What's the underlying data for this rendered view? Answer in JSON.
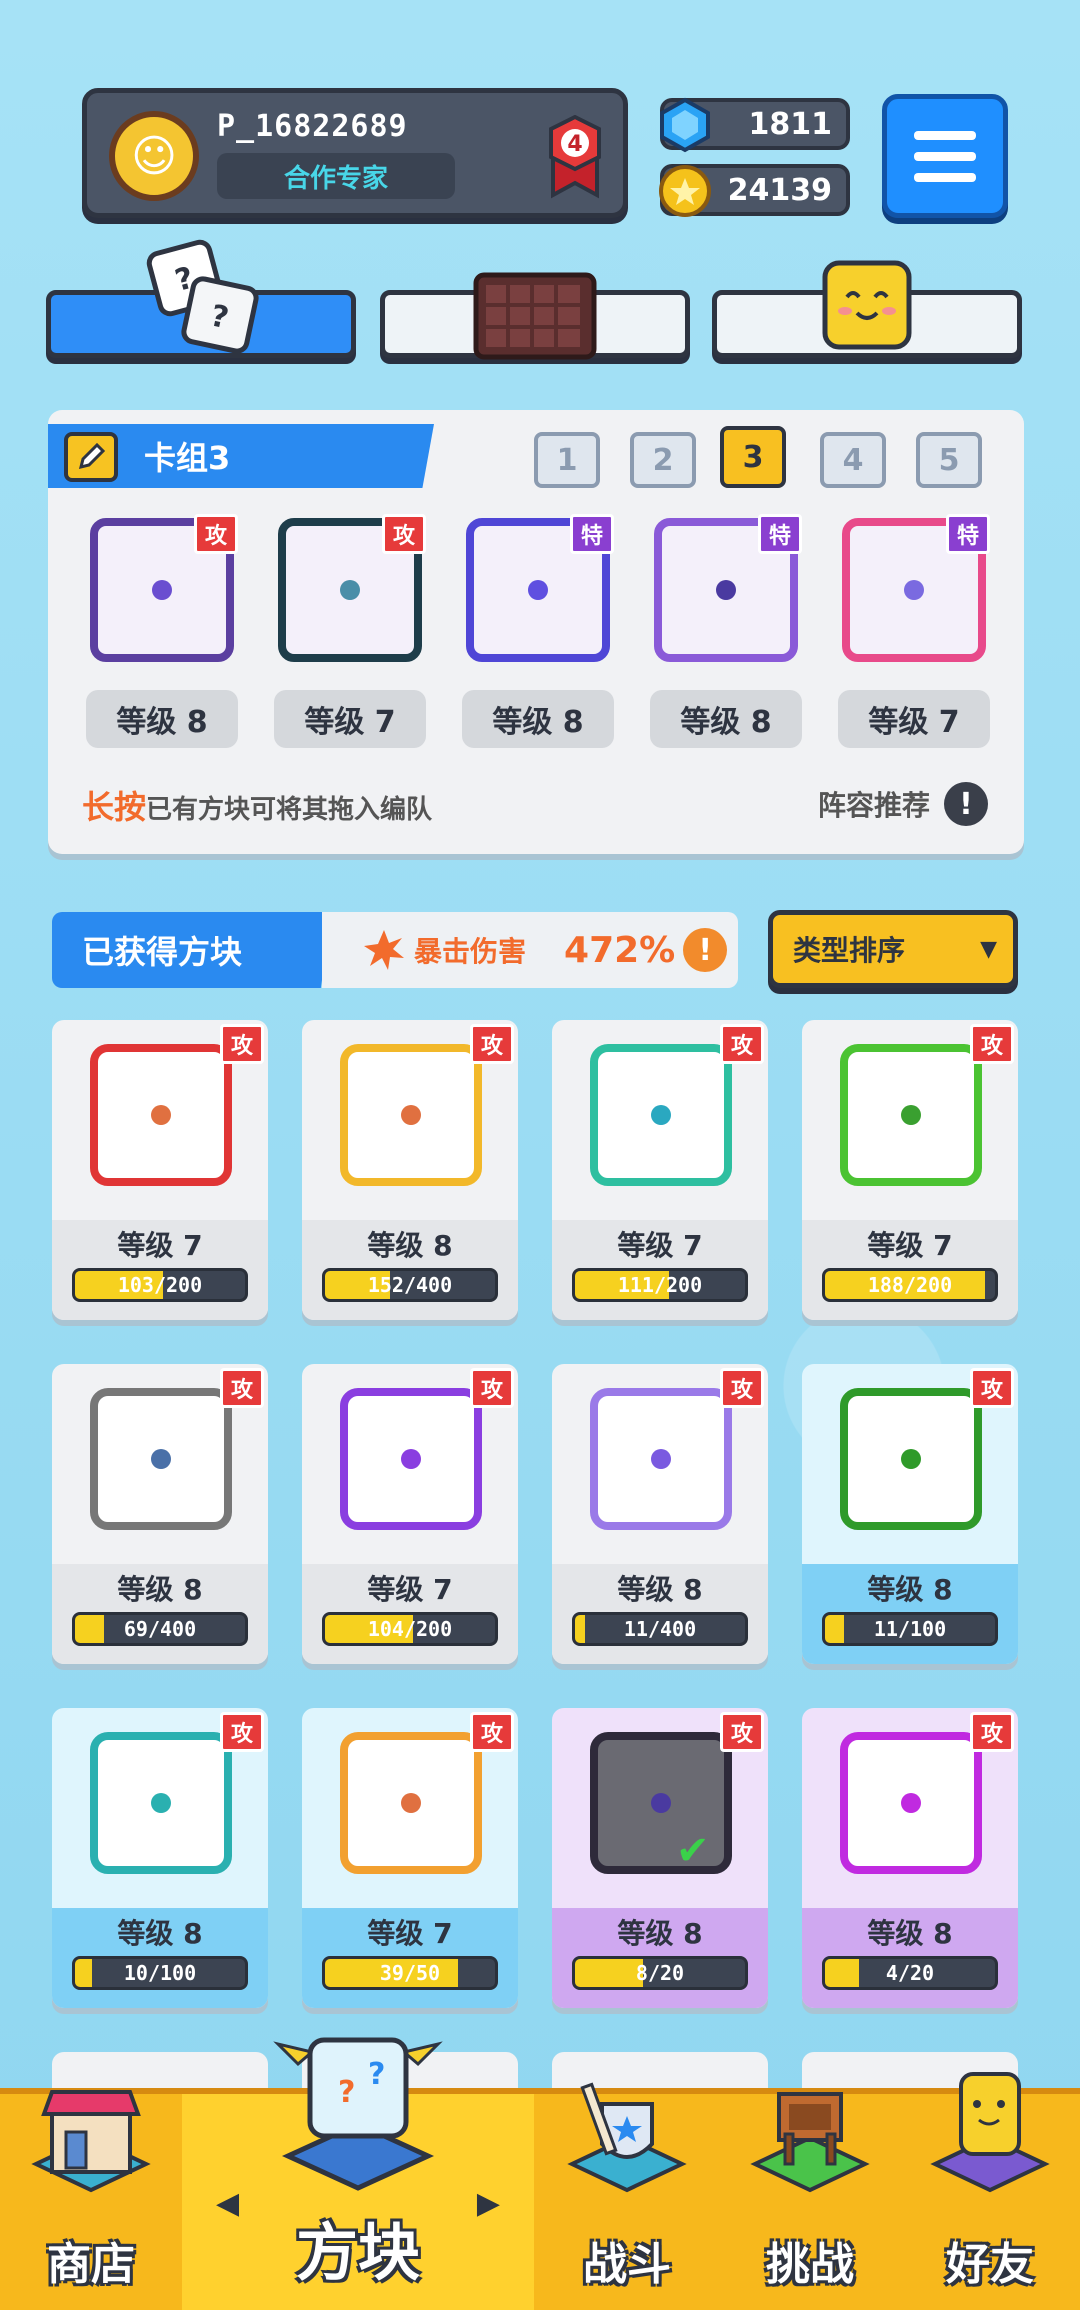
{
  "profile": {
    "username": "P_16822689",
    "title": "合作专家",
    "rank": "4"
  },
  "currency": {
    "gems": "1811",
    "coins": "24139"
  },
  "top_tabs": [
    "dice-tab",
    "board-tab",
    "emoji-tab"
  ],
  "deck": {
    "name": "卡组3",
    "tabs": [
      "1",
      "2",
      "3",
      "4",
      "5"
    ],
    "active_tab": "3",
    "dice": [
      {
        "tag": "攻",
        "level": "等级 8",
        "color": "#5b3fa0",
        "dot": "#6a4ed0"
      },
      {
        "tag": "攻",
        "level": "等级 7",
        "color": "#1e3d4a",
        "dot": "#4a8ea8"
      },
      {
        "tag": "特",
        "level": "等级 8",
        "color": "#4f46d6",
        "dot": "#5f4fe0"
      },
      {
        "tag": "特",
        "level": "等级 8",
        "color": "#8a5ad8",
        "dot": "#4a3aa0"
      },
      {
        "tag": "特",
        "level": "等级 7",
        "color": "#e84a8a",
        "dot": "#7a6ae0"
      }
    ],
    "hint_highlight": "长按",
    "hint_rest": "已有方块可将其拖入编队",
    "recommend": "阵容推荐"
  },
  "collection": {
    "label": "已获得方块",
    "crit_label": "暴击伤害",
    "crit_value": "472%",
    "sort": "类型排序"
  },
  "cards": [
    {
      "tag": "攻",
      "level": "等级 7",
      "progress": "103/200",
      "ratio": 0.515,
      "color": "#e03535",
      "dot": "#e07040",
      "tier": "normal"
    },
    {
      "tag": "攻",
      "level": "等级 8",
      "progress": "152/400",
      "ratio": 0.38,
      "color": "#f2b82a",
      "dot": "#e07040",
      "tier": "normal"
    },
    {
      "tag": "攻",
      "level": "等级 7",
      "progress": "111/200",
      "ratio": 0.555,
      "color": "#2ebfa0",
      "dot": "#2aa8c0",
      "tier": "normal"
    },
    {
      "tag": "攻",
      "level": "等级 7",
      "progress": "188/200",
      "ratio": 0.94,
      "color": "#4bc332",
      "dot": "#3aa030",
      "tier": "normal"
    },
    {
      "tag": "攻",
      "level": "等级 8",
      "progress": "69/400",
      "ratio": 0.17,
      "color": "#777777",
      "dot": "#4a70a8",
      "tier": "normal"
    },
    {
      "tag": "攻",
      "level": "等级 7",
      "progress": "104/200",
      "ratio": 0.52,
      "color": "#8a3ee0",
      "dot": "#8a3ee0",
      "tier": "normal"
    },
    {
      "tag": "攻",
      "level": "等级 8",
      "progress": "11/400",
      "ratio": 0.03,
      "color": "#9a7ae8",
      "dot": "#7a5ae0",
      "tier": "normal"
    },
    {
      "tag": "攻",
      "level": "等级 8",
      "progress": "11/100",
      "ratio": 0.11,
      "color": "#2f9a2a",
      "dot": "#2f9a2a",
      "tier": "rare"
    },
    {
      "tag": "攻",
      "level": "等级 8",
      "progress": "10/100",
      "ratio": 0.1,
      "color": "#2ab0b0",
      "dot": "#2ab0b0",
      "tier": "rare"
    },
    {
      "tag": "攻",
      "level": "等级 7",
      "progress": "39/50",
      "ratio": 0.78,
      "color": "#f2a030",
      "dot": "#e07040",
      "tier": "rare"
    },
    {
      "tag": "攻",
      "level": "等级 8",
      "progress": "8/20",
      "ratio": 0.4,
      "color": "#2e2a3a",
      "dot": "#4a3aa0",
      "tier": "epic",
      "equipped": true
    },
    {
      "tag": "攻",
      "level": "等级 8",
      "progress": "4/20",
      "ratio": 0.2,
      "color": "#c02ae0",
      "dot": "#c02ae0",
      "tier": "epic"
    }
  ],
  "nav": [
    {
      "label": "商店"
    },
    {
      "label": "方块"
    },
    {
      "label": "战斗"
    },
    {
      "label": "挑战"
    },
    {
      "label": "好友"
    }
  ]
}
